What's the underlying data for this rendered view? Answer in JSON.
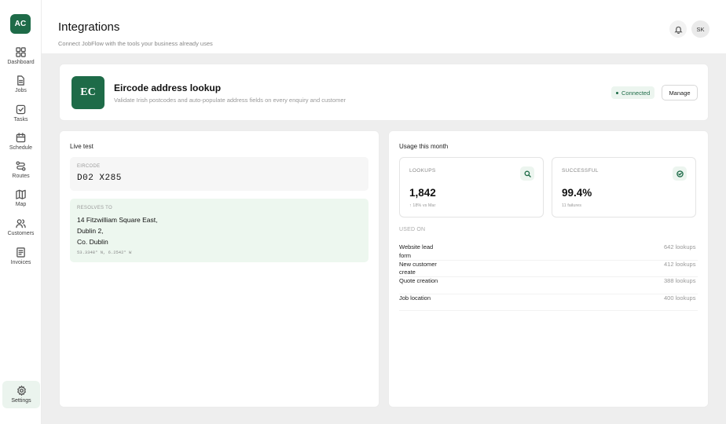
{
  "app": {
    "logo_text": "AC"
  },
  "sidebar": {
    "items": [
      {
        "label": "Dashboard",
        "icon": "grid-icon"
      },
      {
        "label": "Jobs",
        "icon": "file-icon"
      },
      {
        "label": "Tasks",
        "icon": "check-square-icon"
      },
      {
        "label": "Schedule",
        "icon": "calendar-icon"
      },
      {
        "label": "Routes",
        "icon": "route-icon"
      },
      {
        "label": "Map",
        "icon": "map-icon"
      },
      {
        "label": "Customers",
        "icon": "users-icon"
      },
      {
        "label": "Invoices",
        "icon": "invoice-icon"
      }
    ],
    "settings": {
      "label": "Settings",
      "icon": "gear-icon"
    }
  },
  "header": {
    "title": "Integrations",
    "subtitle": "Connect JobFlow with the tools your business already uses",
    "avatar_initials": "SK"
  },
  "integration": {
    "logo_text": "EC",
    "title": "Eircode address lookup",
    "description": "Validate Irish postcodes and auto-populate address fields on every enquiry and customer",
    "status": "Connected",
    "manage_label": "Manage"
  },
  "live_test": {
    "title": "Live test",
    "eircode_label": "EIRCODE",
    "eircode_value": "D02 X285",
    "resolves_label": "RESOLVES TO",
    "address_lines": [
      "14 Fitzwilliam Square East,",
      "Dublin 2,",
      "Co. Dublin"
    ],
    "coordinates": "53.3348° N, 6.2542° W"
  },
  "usage": {
    "title": "Usage this month",
    "lookups": {
      "label": "LOOKUPS",
      "value": "1,842",
      "sub": "↑ 18% vs Mar"
    },
    "successful": {
      "label": "SUCCESSFUL",
      "value": "99.4%",
      "sub": "11 failures"
    },
    "used_on_label": "USED ON",
    "used_on": [
      {
        "name": "Website lead form",
        "count": "642 lookups"
      },
      {
        "name": "New customer create",
        "count": "412 lookups"
      },
      {
        "name": "Quote creation",
        "count": "388 lookups"
      },
      {
        "name": "Job location",
        "count": "400 lookups"
      }
    ]
  },
  "colors": {
    "brand": "#1e6b48",
    "status_bg": "#ecf5ef",
    "resolve_bg": "#edf7ef"
  }
}
